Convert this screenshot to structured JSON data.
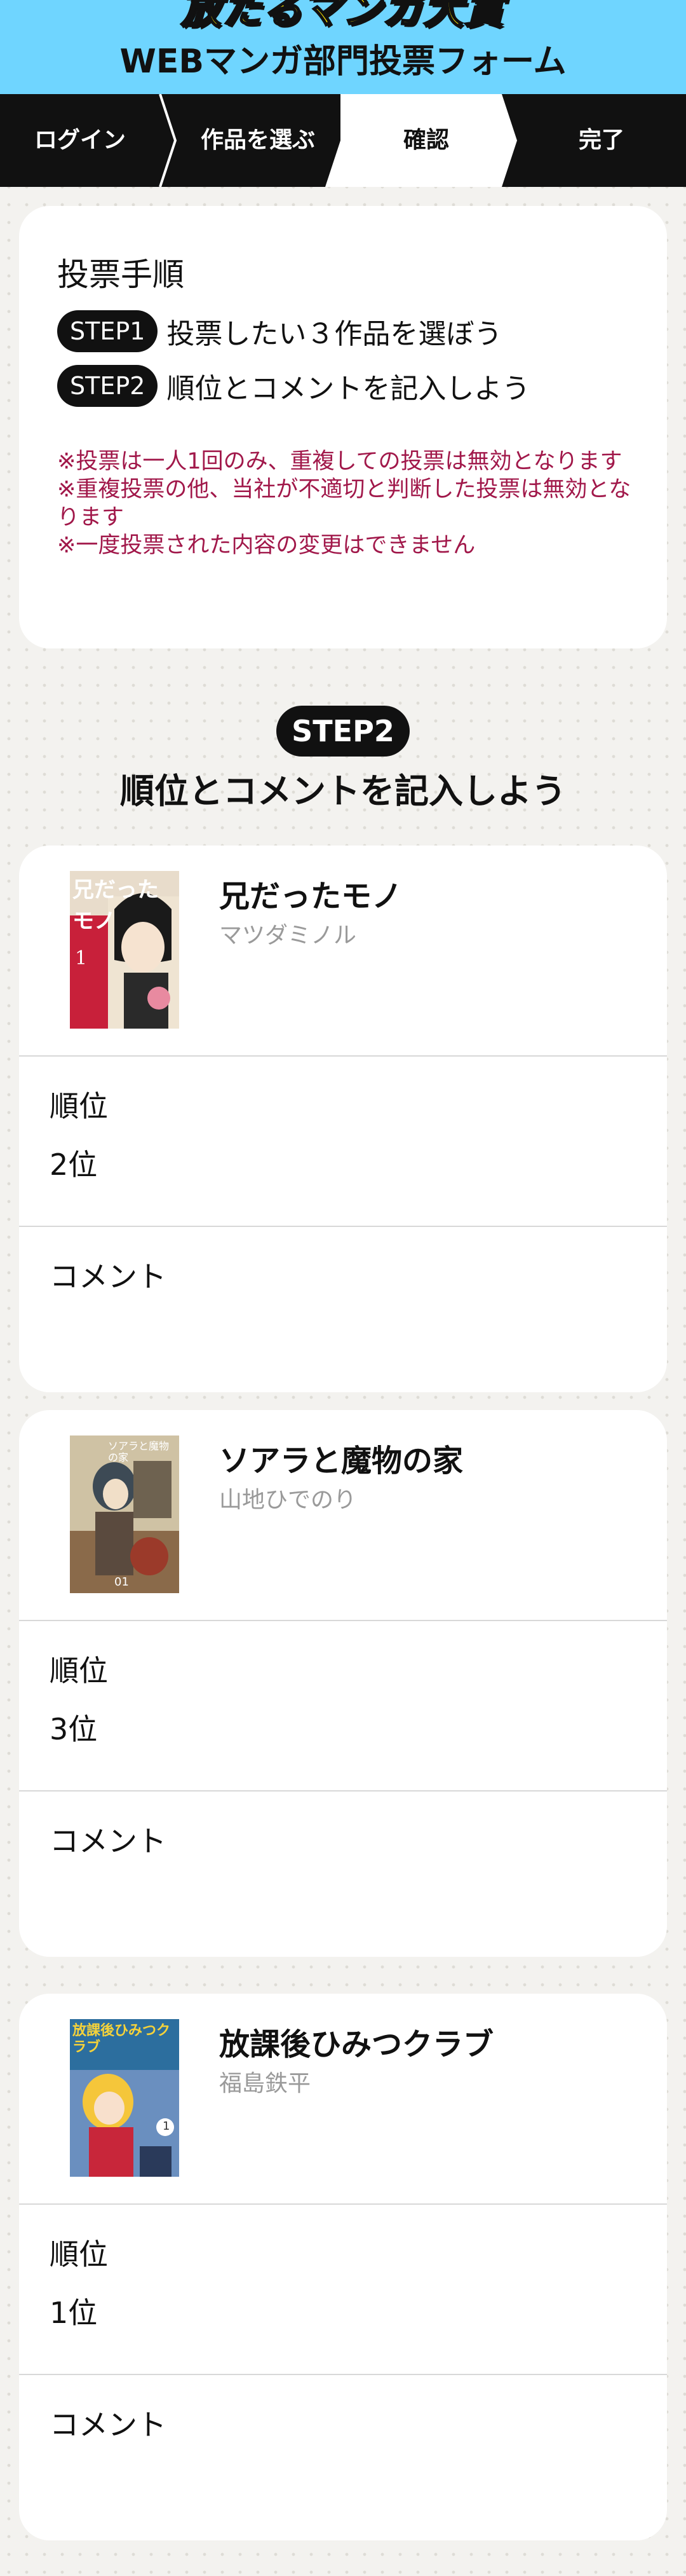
{
  "header": {
    "logo_text": "放たるマンガ大賞",
    "form_title": "WEBマンガ部門投票フォーム"
  },
  "steps_bar": {
    "steps": [
      {
        "label": "ログイン"
      },
      {
        "label": "作品を選ぶ"
      },
      {
        "label": "確認"
      },
      {
        "label": "完了"
      }
    ],
    "active_index": 2,
    "active_color": "#ffffff",
    "inactive_color": "#111111"
  },
  "instructions": {
    "heading": "投票手順",
    "steps": [
      {
        "pill": "STEP1",
        "text": "投票したい３作品を選ぼう"
      },
      {
        "pill": "STEP2",
        "text": "順位とコメントを記入しよう"
      }
    ],
    "notes": [
      "※投票は一人1回のみ、重複しての投票は無効となります",
      "※重複投票の他、当社が不適切と判断した投票は無効となります",
      "※一度投票された内容の変更はできません"
    ],
    "note_color": "#a1184a"
  },
  "section": {
    "pill": "STEP2",
    "title": "順位とコメントを記入しよう"
  },
  "works": [
    {
      "title": "兄だったモノ",
      "author": "マツダミノル",
      "rank_label": "順位",
      "rank_value": "2位",
      "comment_label": "コメント",
      "comment_value": "",
      "cover_text": "兄だったモノ",
      "cover_volume": "1"
    },
    {
      "title": "ソアラと魔物の家",
      "author": "山地ひでのり",
      "rank_label": "順位",
      "rank_value": "3位",
      "comment_label": "コメント",
      "comment_value": "",
      "cover_text": "ソアラと魔物の家",
      "cover_volume": "01"
    },
    {
      "title": "放課後ひみつクラブ",
      "author": "福島鉄平",
      "rank_label": "順位",
      "rank_value": "1位",
      "comment_label": "コメント",
      "comment_value": "",
      "cover_text": "放課後ひみつクラブ",
      "cover_volume": "1"
    }
  ],
  "colors": {
    "header_bg": "#6fd5ff",
    "bar_bg": "#111111",
    "author_gray": "#9a9a9a"
  }
}
